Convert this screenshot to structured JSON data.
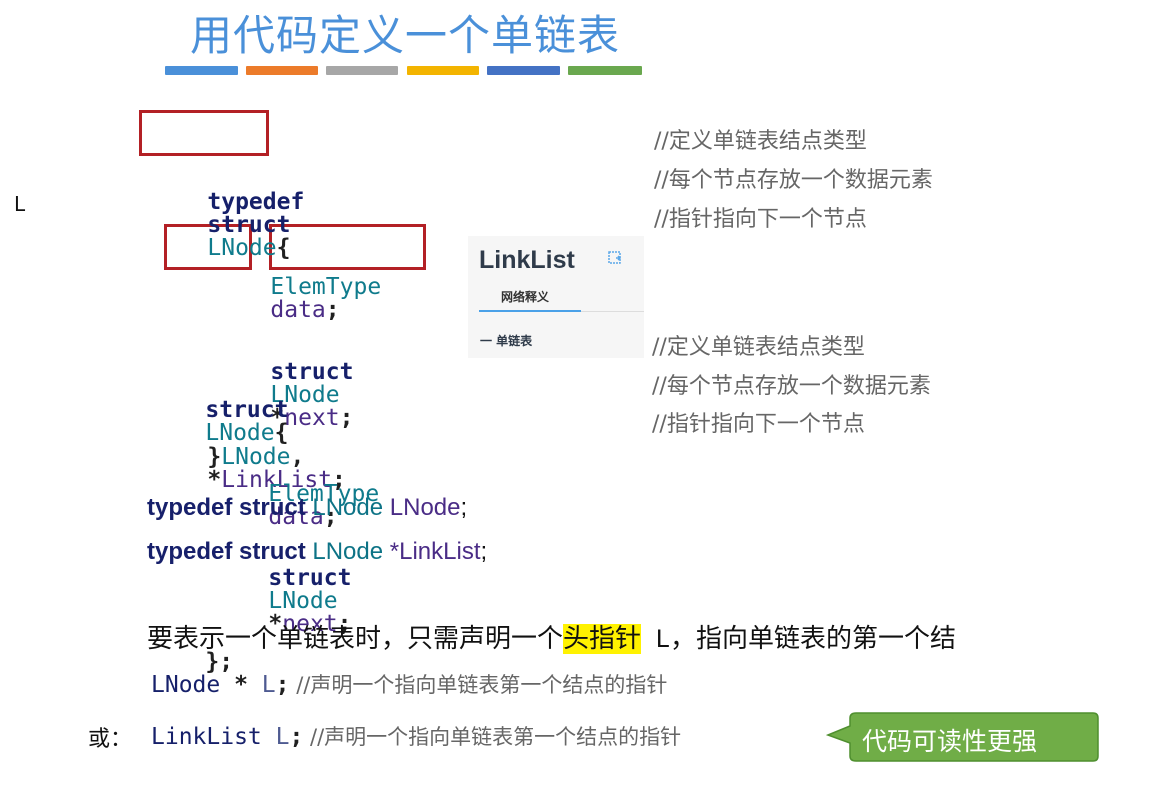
{
  "title": "用代码定义一个单链表",
  "accent_colors": [
    "#4a90d9",
    "#ec7b2a",
    "#a7a7a7",
    "#f3b400",
    "#4472c4",
    "#6aa84f"
  ],
  "side_label": "L",
  "code_block_1": {
    "line1": {
      "typedef": "typedef",
      "struct": "struct",
      "type": "LNode",
      "brace": "{"
    },
    "line2": {
      "type": "ElemType",
      "field": "data",
      "end": ";"
    },
    "line3": {
      "struct": "struct",
      "type": "LNode",
      "star": "*",
      "field": "next",
      "end": ";"
    },
    "line4": {
      "brace": "}",
      "alias1": "LNode",
      "comma": ",",
      "star": "*",
      "alias2": "LinkList",
      "end": ";"
    },
    "comments": [
      "//定义单链表结点类型",
      "//每个节点存放一个数据元素",
      "//指针指向下一个节点"
    ]
  },
  "dictionary_popup": {
    "title": "LinkList",
    "tab": "网络释义",
    "entry": "一 单链表"
  },
  "code_block_2": {
    "line1": {
      "struct": "struct",
      "type": "LNode",
      "brace": "{"
    },
    "line2": {
      "type": "ElemType",
      "field": "data",
      "end": ";"
    },
    "line3": {
      "struct": "struct",
      "type": "LNode",
      "star": "*",
      "field": "next",
      "end": ";"
    },
    "line4": "};",
    "comments": [
      "//定义单链表结点类型",
      "//每个节点存放一个数据元素",
      "//指针指向下一个节点"
    ]
  },
  "typedef_lines": [
    {
      "kw": "typedef struct",
      "type": "LNode",
      "name": "LNode",
      "end": ";"
    },
    {
      "kw": "typedef struct",
      "type": "LNode",
      "name": "*LinkList",
      "end": ";"
    }
  ],
  "description": {
    "before": "要表示一个单链表时，只需声明一个",
    "highlight": "头指针",
    "middle": " L",
    "after": "，指向单链表的第一个结"
  },
  "declarations": {
    "first": {
      "type": "LNode",
      "star": " * ",
      "var": "L",
      "end": ";",
      "comment": "  //声明一个指向单链表第一个结点的指针"
    },
    "or_label": "或：",
    "second": {
      "type": "LinkList",
      "var": " L",
      "end": ";",
      "comment": " //声明一个指向单链表第一个结点的指针"
    }
  },
  "callout": {
    "text": "代码可读性更强",
    "color": "#70ad47",
    "border": "#4f8f2f"
  }
}
